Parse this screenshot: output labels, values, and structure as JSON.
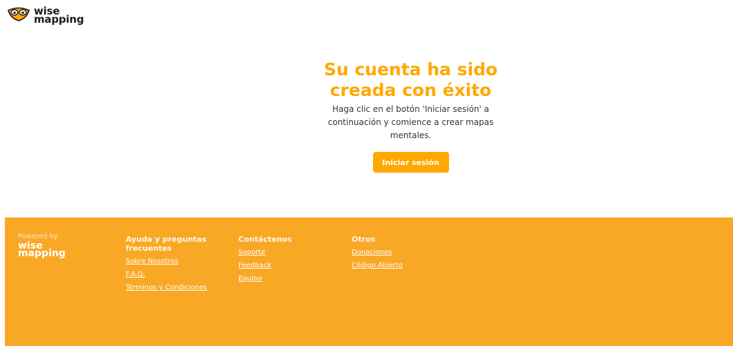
{
  "header": {
    "logo_line1": "wise",
    "logo_line2": "mapping"
  },
  "main": {
    "title_line1": "Su cuenta ha sido",
    "title_line2": "creada con éxito",
    "message": "Haga clic en el botón 'Iniciar sesión' a continuación y comience a crear mapas mentales.",
    "login_button": "Iniciar sesión"
  },
  "footer": {
    "powered_by": "Powered by",
    "logo_line1": "wise",
    "logo_line2": "mapping",
    "help": {
      "title_line1": "Ayuda y preguntas",
      "title_line2": "frecuentes",
      "links": [
        "Sobre Nosotros",
        "F.A.Q.",
        "Términos y Condiciones"
      ]
    },
    "contact": {
      "title": "Contáctenos",
      "links": [
        "Soporte",
        "Feedback",
        "Equipo"
      ]
    },
    "others": {
      "title": "Otros",
      "links": [
        "Donaciones",
        "Código Abierto"
      ]
    }
  },
  "colors": {
    "accent": "#ffa800",
    "footer_bg": "#f9a826"
  },
  "icons": {
    "logo": "wisemapping-logo-icon"
  }
}
